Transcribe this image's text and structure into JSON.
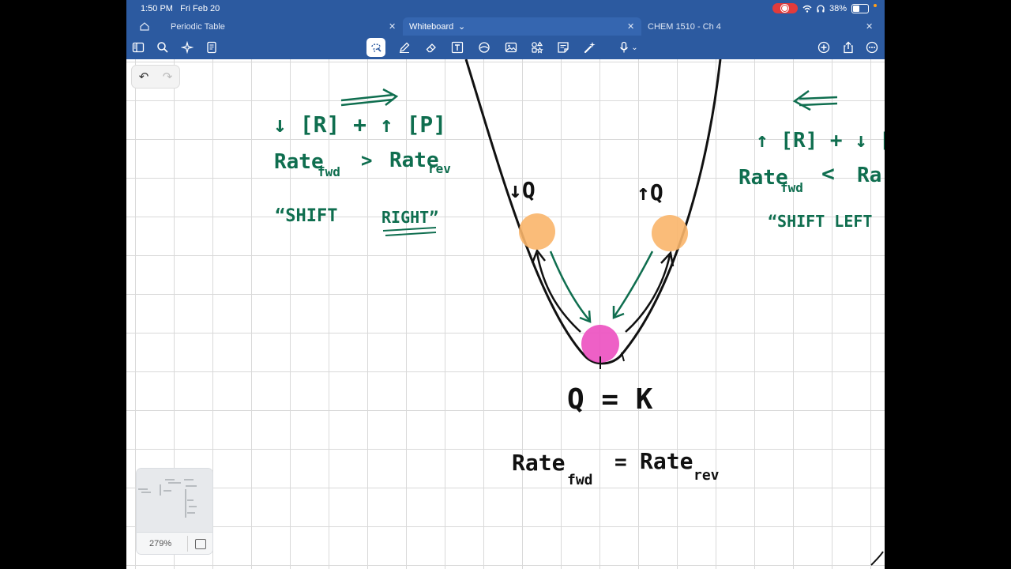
{
  "status": {
    "time": "1:50 PM",
    "date": "Fri Feb 20",
    "battery": "38%",
    "battery_level": 0.38
  },
  "tabs": [
    {
      "label": "Periodic Table",
      "active": false
    },
    {
      "label": "Whiteboard",
      "active": true
    },
    {
      "label": "CHEM 1510 - Ch 4",
      "active": false
    }
  ],
  "toolbar": {
    "left_icons": [
      "sidebar-icon",
      "search-icon",
      "sparkle-icon",
      "document-icon"
    ],
    "tools": [
      "lasso-icon",
      "pen-icon",
      "eraser-icon",
      "text-box-icon",
      "shapes-icon",
      "image-icon",
      "elements-icon",
      "sticky-note-icon",
      "laser-pointer-icon",
      "microphone-icon"
    ],
    "right_icons": [
      "add-icon",
      "share-icon",
      "more-icon"
    ]
  },
  "notes": {
    "left_line1": "↓ [R] + ↑ [P]",
    "left_line2_main": "Rate",
    "left_line2_sub": "fwd",
    "left_line2_op": ">",
    "left_line2_main2": "Rate",
    "left_line2_sub2": "rev",
    "left_line3_a": "“SHIFT",
    "left_line3_b": "RIGHT”",
    "right_line1": "↑ [R] + ↓ [P",
    "right_line2_main": "Rate",
    "right_line2_sub": "fwd",
    "right_line2_op": "<",
    "right_line2_main2": "Ra",
    "right_line3": "“SHIFT LEFT",
    "label_down_q": "↓Q",
    "label_up_q": "↑Q",
    "equilibrium": "Q = K",
    "rate_main1": "Rate",
    "rate_sub1": "fwd",
    "rate_eq": "=",
    "rate_main2": "Rate",
    "rate_sub2": "rev"
  },
  "colors": {
    "header": "#2c5aa0",
    "ink_green": "#0f6e4f",
    "ink_black": "#111111",
    "ball_orange": "#f9b56a",
    "ball_pink": "#ec4fc0"
  },
  "minimap": {
    "zoom": "279%"
  }
}
